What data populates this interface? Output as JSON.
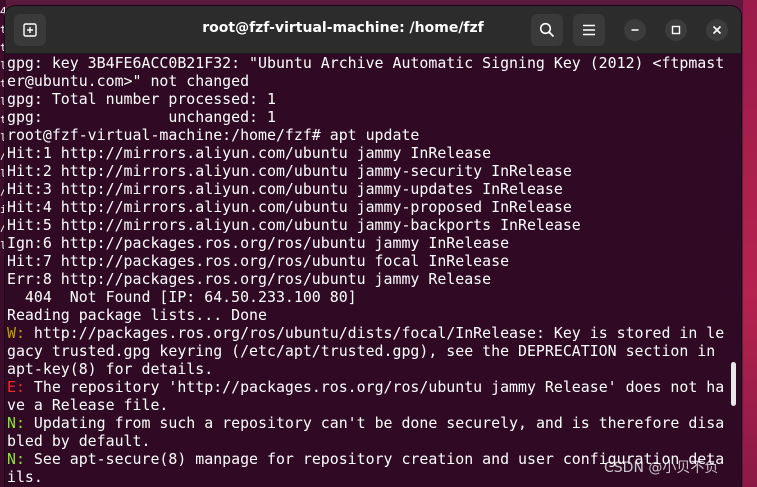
{
  "window": {
    "title": "root@fzf-virtual-machine: /home/fzf"
  },
  "desktop": {
    "left_glyphs": [
      "4",
      "t",
      "t",
      "l",
      "t",
      "l",
      "t",
      "l",
      "/",
      "l",
      "/",
      "i",
      "/",
      "l"
    ]
  },
  "terminal": {
    "lines": [
      {
        "text": "gpg: key 3B4FE6ACC0B21F32: \"Ubuntu Archive Automatic Signing Key (2012) <ftpmast"
      },
      {
        "text": "er@ubuntu.com>\" not changed"
      },
      {
        "text": "gpg: Total number processed: 1"
      },
      {
        "text": "gpg:              unchanged: 1"
      },
      {
        "text": "root@fzf-virtual-machine:/home/fzf# apt update"
      },
      {
        "text": "Hit:1 http://mirrors.aliyun.com/ubuntu jammy InRelease"
      },
      {
        "text": "Hit:2 http://mirrors.aliyun.com/ubuntu jammy-security InRelease"
      },
      {
        "text": "Hit:3 http://mirrors.aliyun.com/ubuntu jammy-updates InRelease"
      },
      {
        "text": "Hit:4 http://mirrors.aliyun.com/ubuntu jammy-proposed InRelease"
      },
      {
        "text": "Hit:5 http://mirrors.aliyun.com/ubuntu jammy-backports InRelease"
      },
      {
        "text": "Ign:6 http://packages.ros.org/ros/ubuntu jammy InRelease"
      },
      {
        "text": "Hit:7 http://packages.ros.org/ros/ubuntu focal InRelease"
      },
      {
        "text": "Err:8 http://packages.ros.org/ros/ubuntu jammy Release"
      },
      {
        "text": "  404  Not Found [IP: 64.50.233.100 80]"
      },
      {
        "text": "Reading package lists... Done"
      },
      {
        "prefix": "W:",
        "kind": "w",
        "text": " http://packages.ros.org/ros/ubuntu/dists/focal/InRelease: Key is stored in le"
      },
      {
        "text": "gacy trusted.gpg keyring (/etc/apt/trusted.gpg), see the DEPRECATION section in"
      },
      {
        "text": "apt-key(8) for details."
      },
      {
        "prefix": "E:",
        "kind": "e",
        "text": " The repository 'http://packages.ros.org/ros/ubuntu jammy Release' does not ha"
      },
      {
        "text": "ve a Release file."
      },
      {
        "prefix": "N:",
        "kind": "n",
        "text": " Updating from such a repository can't be done securely, and is therefore disa"
      },
      {
        "text": "bled by default."
      },
      {
        "prefix": "N:",
        "kind": "n",
        "text": " See apt-secure(8) manpage for repository creation and user configuration deta"
      },
      {
        "text": "ils."
      }
    ]
  },
  "watermark": {
    "text": "CSDN @小贝不负"
  },
  "icons": {
    "new_tab": "new-tab-icon",
    "search": "search-icon",
    "menu": "hamburger-menu-icon",
    "minimize": "minimize-icon",
    "maximize": "maximize-icon",
    "close": "close-icon"
  },
  "colors": {
    "terminal_bg": "#300a24",
    "titlebar_bg": "#2c2c2c",
    "warning": "#c4a000",
    "error": "#ef2929",
    "notice": "#8ae234"
  }
}
